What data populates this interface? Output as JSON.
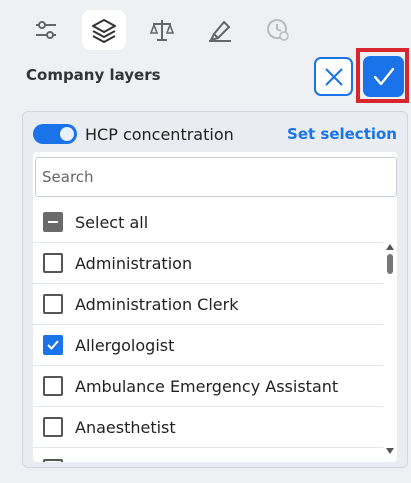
{
  "toolbar": {
    "tools": [
      {
        "icon": "sliders-icon",
        "active": false
      },
      {
        "icon": "layers-icon",
        "active": true
      },
      {
        "icon": "scale-icon",
        "active": false
      },
      {
        "icon": "highlighter-icon",
        "active": false
      },
      {
        "icon": "history-clock-icon",
        "active": false
      }
    ]
  },
  "header": {
    "title": "Company layers"
  },
  "panel": {
    "toggle_label": "HCP concentration",
    "toggle_on": true,
    "set_selection": "Set selection",
    "search_placeholder": "Search",
    "select_all": "Select all",
    "items": [
      {
        "label": "Administration",
        "checked": false
      },
      {
        "label": "Administration Clerk",
        "checked": false
      },
      {
        "label": "Allergologist",
        "checked": true
      },
      {
        "label": "Ambulance Emergency Assistant",
        "checked": false
      },
      {
        "label": "Anaesthetist",
        "checked": false
      }
    ]
  },
  "colors": {
    "accent": "#1a73e8",
    "highlight_frame": "#d8262e"
  }
}
